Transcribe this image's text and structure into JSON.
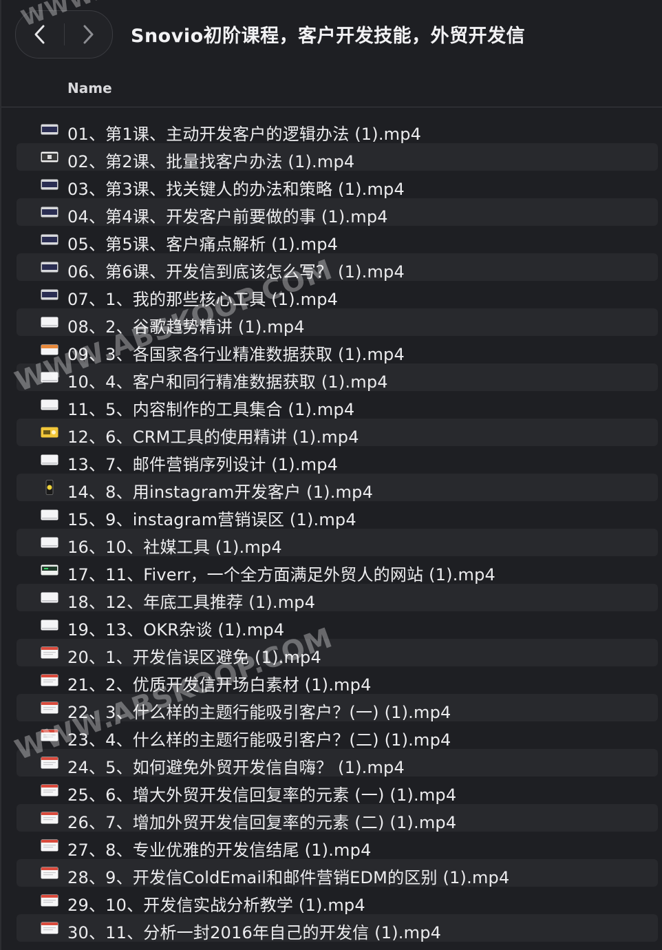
{
  "window": {
    "title": "Snovio初阶课程，客户开发技能，外贸开发信"
  },
  "navigation": {
    "back_icon": "chevron-left-icon",
    "forward_icon": "chevron-right-icon"
  },
  "columns": {
    "name": "Name"
  },
  "watermark": {
    "text": "WWW.ABSKOOP.COM"
  },
  "colors": {
    "background": "#1e1f23",
    "row_alt": "#28292d",
    "text": "#ececee"
  },
  "files": [
    {
      "name": "01、第1课、主动开发客户的逻辑办法 (1).mp4",
      "icon": "dark-thumb"
    },
    {
      "name": "02、第2课、批量找客户办法 (1).mp4",
      "icon": "light-thumb"
    },
    {
      "name": "03、第3课、找关键人的办法和策略 (1).mp4",
      "icon": "dark-thumb"
    },
    {
      "name": "04、第4课、开发客户前要做的事 (1).mp4",
      "icon": "dark-thumb"
    },
    {
      "name": "05、第5课、客户痛点解析 (1).mp4",
      "icon": "dark-thumb"
    },
    {
      "name": "06、第6课、开发信到底该怎么写？ (1).mp4",
      "icon": "dark-thumb"
    },
    {
      "name": "07、1、我的那些核心工具 (1).mp4",
      "icon": "dark-thumb"
    },
    {
      "name": "08、2、谷歌趋势精讲 (1).mp4",
      "icon": "white-thumb"
    },
    {
      "name": "09、3、各国家各行业精准数据获取 (1).mp4",
      "icon": "orange-thumb"
    },
    {
      "name": "10、4、客户和同行精准数据获取 (1).mp4",
      "icon": "white-thumb"
    },
    {
      "name": "11、5、内容制作的工具集合 (1).mp4",
      "icon": "white-thumb"
    },
    {
      "name": "12、6、CRM工具的使用精讲 (1).mp4",
      "icon": "yellow-thumb"
    },
    {
      "name": "13、7、邮件营销序列设计 (1).mp4",
      "icon": "white-thumb"
    },
    {
      "name": "14、8、用instagram开发客户 (1).mp4",
      "icon": "phone-thumb"
    },
    {
      "name": "15、9、instagram营销误区 (1).mp4",
      "icon": "white-thumb"
    },
    {
      "name": "16、10、社媒工具 (1).mp4",
      "icon": "white-thumb"
    },
    {
      "name": "17、11、Fiverr，一个全方面满足外贸人的网站 (1).mp4",
      "icon": "green-thumb"
    },
    {
      "name": "18、12、年底工具推荐 (1).mp4",
      "icon": "white-thumb"
    },
    {
      "name": "19、13、OKR杂谈 (1).mp4",
      "icon": "white-thumb"
    },
    {
      "name": "20、1、开发信误区避免 (1).mp4",
      "icon": "red-thumb"
    },
    {
      "name": "21、2、优质开发信开场白素材 (1).mp4",
      "icon": "red-thumb"
    },
    {
      "name": "22、3、什么样的主题行能吸引客户？(一) (1).mp4",
      "icon": "red-thumb"
    },
    {
      "name": "23、4、什么样的主题行能吸引客户？(二) (1).mp4",
      "icon": "red-thumb"
    },
    {
      "name": "24、5、如何避免外贸开发信自嗨？ (1).mp4",
      "icon": "red-thumb"
    },
    {
      "name": "25、6、增大外贸开发信回复率的元素 (一) (1).mp4",
      "icon": "red-thumb"
    },
    {
      "name": "26、7、增加外贸开发信回复率的元素 (二) (1).mp4",
      "icon": "red-thumb"
    },
    {
      "name": "27、8、专业优雅的开发信结尾 (1).mp4",
      "icon": "red-thumb"
    },
    {
      "name": "28、9、开发信ColdEmail和邮件营销EDM的区别 (1).mp4",
      "icon": "red-thumb"
    },
    {
      "name": "29、10、开发信实战分析教学 (1).mp4",
      "icon": "red-thumb"
    },
    {
      "name": "30、11、分析一封2016年自己的开发信 (1).mp4",
      "icon": "red-thumb"
    }
  ]
}
